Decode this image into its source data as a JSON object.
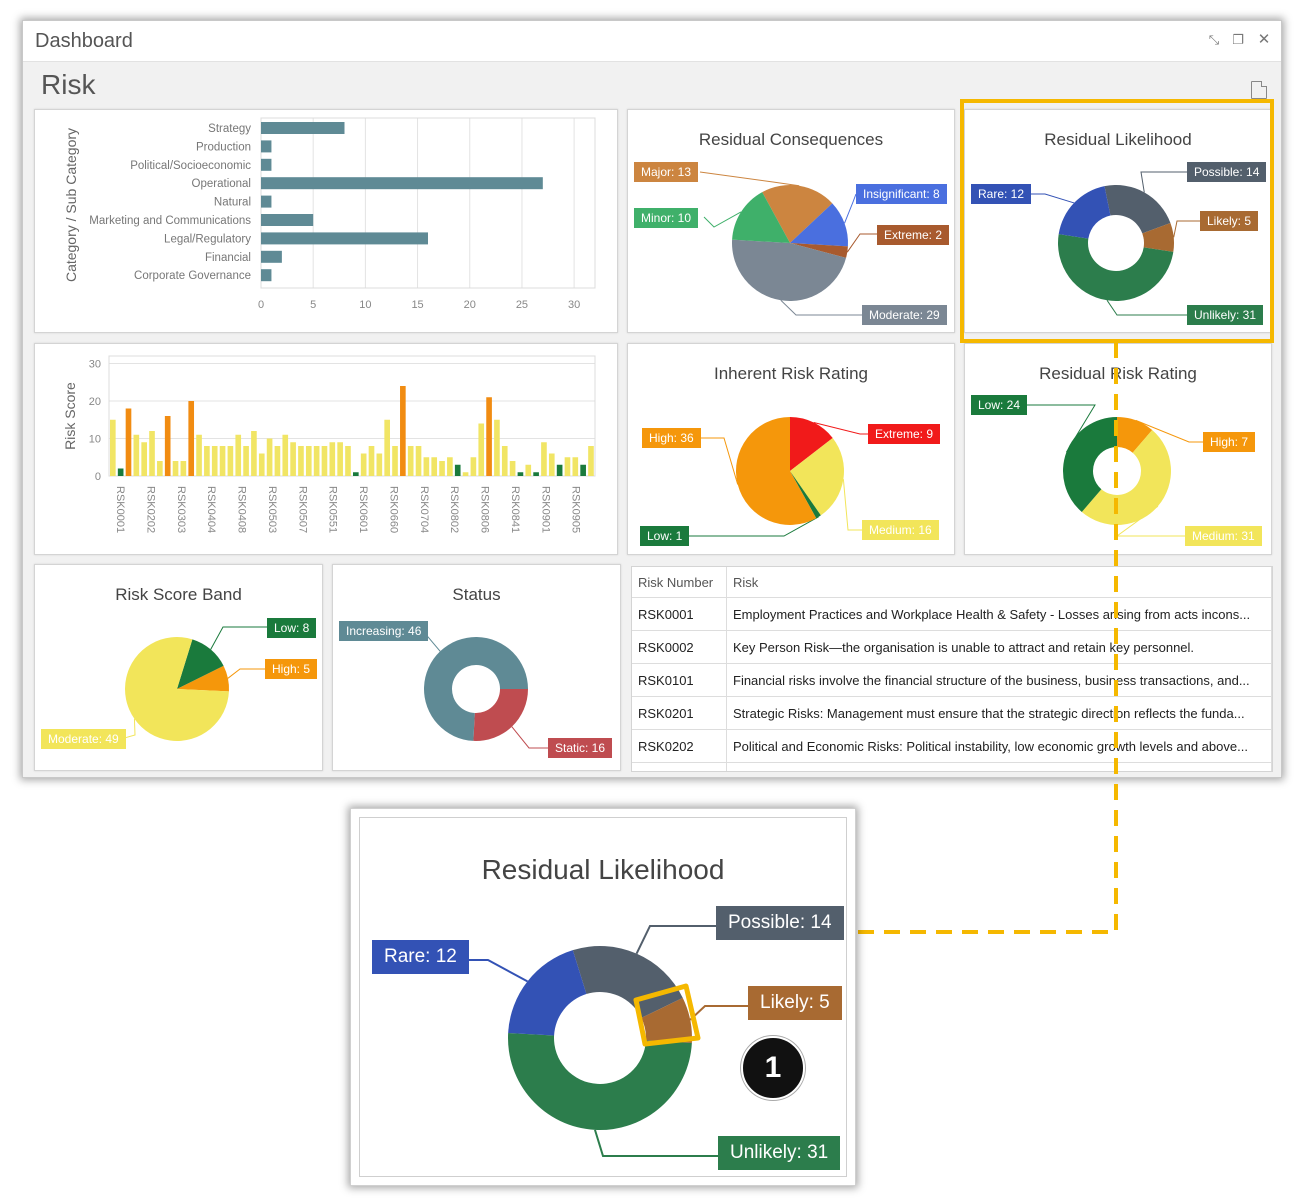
{
  "window": {
    "title": "Dashboard",
    "page_title": "Risk"
  },
  "category_chart": {
    "ylabel": "Category / Sub Category",
    "categories": [
      "Strategy",
      "Production",
      "Political/Socioeconomic",
      "Operational",
      "Natural",
      "Marketing and Communications",
      "Legal/Regulatory",
      "Financial",
      "Corporate Governance"
    ],
    "values": [
      8,
      1,
      1,
      27,
      1,
      5,
      16,
      2,
      1
    ],
    "xticks": [
      0,
      5,
      10,
      15,
      20,
      25,
      30
    ],
    "xlim": [
      0,
      32
    ],
    "color": "#5f8a95"
  },
  "risk_score_chart": {
    "ylabel": "Risk Score",
    "yticks": [
      0,
      10,
      20,
      30
    ],
    "ylim": [
      0,
      32
    ],
    "values": [
      15,
      2,
      18,
      11,
      9,
      12,
      4,
      16,
      4,
      4,
      20,
      11,
      8,
      8,
      8,
      8,
      11,
      8,
      12,
      6,
      10,
      8,
      11,
      9,
      8,
      8,
      8,
      8,
      9,
      9,
      8,
      1,
      6,
      8,
      6,
      15,
      8,
      24,
      8,
      8,
      5,
      5,
      4,
      5,
      3,
      1,
      5,
      14,
      21,
      15,
      8,
      4,
      1,
      3,
      1,
      9,
      6,
      3,
      5,
      5,
      3,
      8
    ],
    "colors": [
      "y",
      "g",
      "o",
      "y",
      "y",
      "y",
      "y",
      "o",
      "y",
      "y",
      "o",
      "y",
      "y",
      "y",
      "y",
      "y",
      "y",
      "y",
      "y",
      "y",
      "y",
      "y",
      "y",
      "y",
      "y",
      "y",
      "y",
      "y",
      "y",
      "y",
      "y",
      "g",
      "y",
      "y",
      "y",
      "y",
      "y",
      "o",
      "y",
      "y",
      "y",
      "y",
      "y",
      "y",
      "g",
      "y",
      "y",
      "y",
      "o",
      "y",
      "y",
      "y",
      "g",
      "y",
      "g",
      "y",
      "y",
      "g",
      "y",
      "y",
      "g",
      "y"
    ],
    "xlabels": [
      "RSK0001",
      "RSK0202",
      "RSK0303",
      "RSK0404",
      "RSK0408",
      "RSK0503",
      "RSK0507",
      "RSK0551",
      "RSK0601",
      "RSK0660",
      "RSK0704",
      "RSK0802",
      "RSK0806",
      "RSK0841",
      "RSK0901",
      "RSK0905"
    ],
    "palette": {
      "y": "#f1e565",
      "o": "#f18c12",
      "g": "#1a7a3c"
    }
  },
  "residual_consequences": {
    "title": "Residual Consequences",
    "slices": [
      {
        "label": "Major: 13",
        "value": 13,
        "color": "#cc8540"
      },
      {
        "label": "Insignificant: 8",
        "value": 8,
        "color": "#4a6fdf"
      },
      {
        "label": "Extreme: 2",
        "value": 2,
        "color": "#a85a2e"
      },
      {
        "label": "Moderate: 29",
        "value": 29,
        "color": "#7b8794"
      },
      {
        "label": "Minor: 10",
        "value": 10,
        "color": "#3fb06a"
      }
    ]
  },
  "residual_likelihood": {
    "title": "Residual Likelihood",
    "slices": [
      {
        "label": "Possible: 14",
        "value": 14,
        "color": "#535f6c"
      },
      {
        "label": "Likely: 5",
        "value": 5,
        "color": "#a86a32"
      },
      {
        "label": "Unlikely: 31",
        "value": 31,
        "color": "#2c7d4c"
      },
      {
        "label": "Rare: 12",
        "value": 12,
        "color": "#3352b5"
      }
    ]
  },
  "inherent_risk_rating": {
    "title": "Inherent Risk Rating",
    "slices": [
      {
        "label": "Extreme: 9",
        "value": 9,
        "color": "#f11a1a"
      },
      {
        "label": "Medium: 16",
        "value": 16,
        "color": "#f2e55a"
      },
      {
        "label": "Low: 1",
        "value": 1,
        "color": "#1a7a3c"
      },
      {
        "label": "High: 36",
        "value": 36,
        "color": "#f5970b"
      }
    ]
  },
  "residual_risk_rating": {
    "title": "Residual Risk Rating",
    "slices": [
      {
        "label": "High: 7",
        "value": 7,
        "color": "#f5970b"
      },
      {
        "label": "Medium: 31",
        "value": 31,
        "color": "#f2e55a"
      },
      {
        "label": "Low: 24",
        "value": 24,
        "color": "#1a7a3c"
      }
    ]
  },
  "risk_score_band": {
    "title": "Risk Score Band",
    "slices": [
      {
        "label": "Low: 8",
        "value": 8,
        "color": "#1a7a3c"
      },
      {
        "label": "High: 5",
        "value": 5,
        "color": "#f5970b"
      },
      {
        "label": "Moderate: 49",
        "value": 49,
        "color": "#f2e55a"
      }
    ]
  },
  "status": {
    "title": "Status",
    "slices": [
      {
        "label": "Static: 16",
        "value": 16,
        "color": "#bf4c50"
      },
      {
        "label": "Increasing: 46",
        "value": 46,
        "color": "#5f8a95"
      }
    ]
  },
  "risk_table": {
    "headers": [
      "Risk Number",
      "Risk"
    ],
    "rows": [
      [
        "RSK0001",
        "Employment Practices and Workplace Health & Safety - Losses arising from acts incons..."
      ],
      [
        "RSK0002",
        "Key Person Risk—the organisation is unable to attract and retain key personnel."
      ],
      [
        "RSK0101",
        "Financial risks involve the financial structure of the business, business transactions, and..."
      ],
      [
        "RSK0201",
        "Strategic Risks: Management must ensure that the strategic direction reflects the funda..."
      ],
      [
        "RSK0202",
        "Political and Economic Risks: Political instability, low economic growth levels and above..."
      ]
    ]
  },
  "callout": {
    "number": "1",
    "highlight_color": "#f5b800"
  }
}
